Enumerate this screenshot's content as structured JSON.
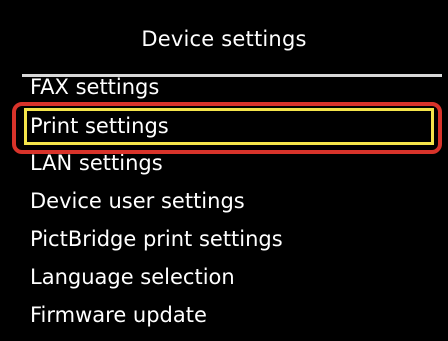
{
  "screen": {
    "title": "Device settings"
  },
  "menu": {
    "items": [
      {
        "label": "FAX settings"
      },
      {
        "label": "Print settings"
      },
      {
        "label": "LAN settings"
      },
      {
        "label": "Device user settings"
      },
      {
        "label": "PictBridge print settings"
      },
      {
        "label": "Language selection"
      },
      {
        "label": "Firmware update"
      }
    ],
    "selected_index": 1
  },
  "colors": {
    "background": "#000000",
    "text": "#ffffff",
    "selection_border": "#f4e44a",
    "callout_ring": "#d8332a"
  }
}
